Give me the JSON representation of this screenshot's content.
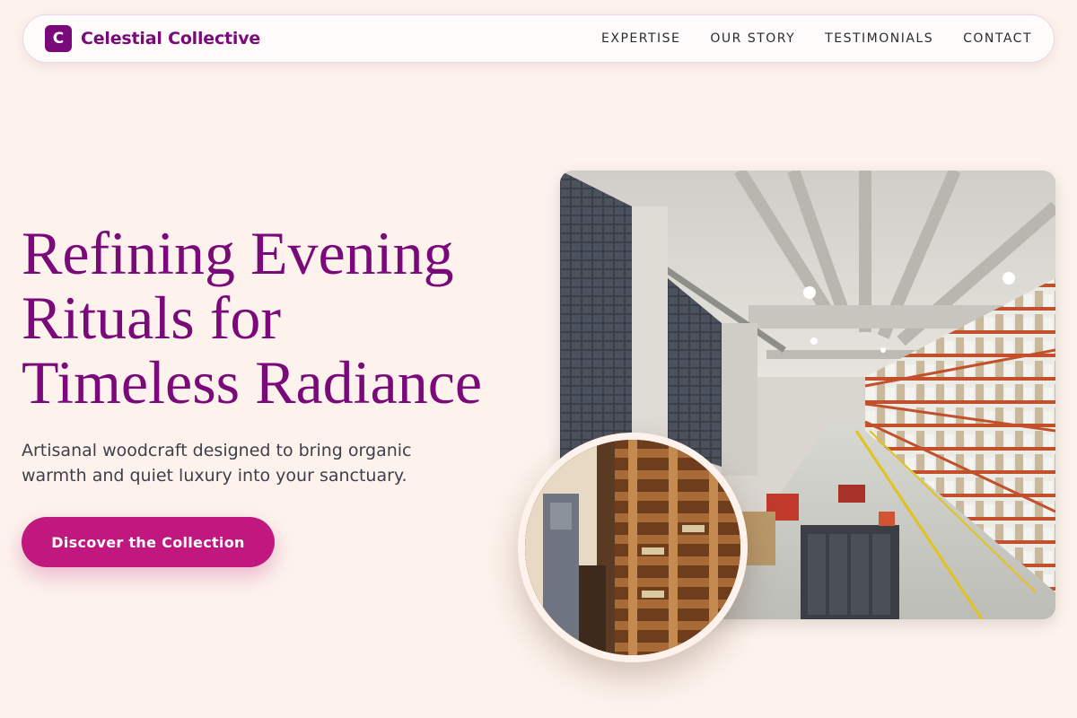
{
  "brand": {
    "mark": "C",
    "name": "Celestial Collective"
  },
  "nav": {
    "items": [
      {
        "label": "EXPERTISE"
      },
      {
        "label": "OUR STORY"
      },
      {
        "label": "TESTIMONIALS"
      },
      {
        "label": "CONTACT"
      }
    ]
  },
  "hero": {
    "headline_lines": [
      "Refining Evening",
      "Rituals for",
      "Timeless Radiance"
    ],
    "subtitle": "Artisanal woodcraft designed to bring organic warmth and quiet luxury into your sanctuary.",
    "cta_label": "Discover the Collection"
  },
  "images": {
    "main": "warehouse-aisle-photo",
    "inset": "stacked-wooden-pallets-photo"
  },
  "colors": {
    "background": "#fdf3ec",
    "brand_purple": "#7a0a7a",
    "cta_magenta": "#c0187e",
    "body_text": "#3d3f4c"
  }
}
